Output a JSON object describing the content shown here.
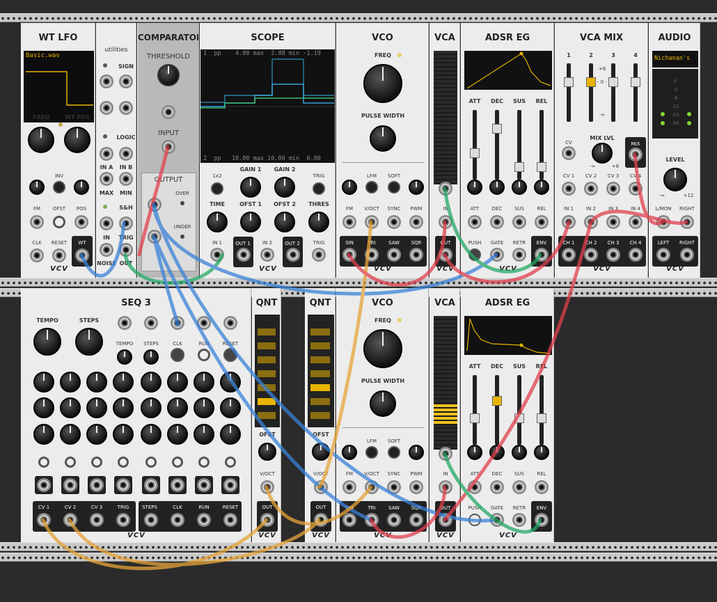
{
  "colors": {
    "red": "#e0404e",
    "green": "#24a866",
    "blue": "#3a82d8",
    "yellow": "#e6a43a"
  },
  "modules": {
    "wtlfo": {
      "title": "WT LFO",
      "file": "Basic.wav",
      "freq": "FREQ",
      "wtpos": "WT POS",
      "inv": "INV",
      "fm": "FM",
      "ofst": "OFST",
      "pos": "POS",
      "clk": "CLK",
      "reset": "RESET",
      "wt": "WT",
      "brand": "VCV"
    },
    "util": {
      "title": "utilities",
      "sign": "SIGN",
      "logic": "LOGIC",
      "ina": "IN A",
      "inb": "IN B",
      "max": "MAX",
      "min": "MIN",
      "sh": "S&H",
      "in": "IN",
      "trig": "TRIG",
      "noise": "NOISE",
      "out": "OUT"
    },
    "comp": {
      "title": "COMPARATOR",
      "threshold": "THRESHOLD",
      "input": "INPUT",
      "output": "OUTPUT",
      "over": "OVER",
      "under": "UNDER"
    },
    "scope": {
      "title": "SCOPE",
      "top": "1  pp    4.08 max  2.88 min -1.19",
      "bottom": "2  pp   10.00 max 10.00 min  0.00",
      "x2": "1x2",
      "gain1": "GAIN 1",
      "gain2": "GAIN 2",
      "trig": "TRIG",
      "time": "TIME",
      "ofst1": "OFST 1",
      "ofst2": "OFST 2",
      "thres": "THRES",
      "in1": "IN 1",
      "out1": "OUT 1",
      "in2": "IN 2",
      "out2": "OUT 2",
      "trigj": "TRIG",
      "brand": "VCV"
    },
    "vco": {
      "title": "VCO",
      "freq": "FREQ",
      "pw": "PULSE WIDTH",
      "lfm": "LFM",
      "soft": "SOFT",
      "fm": "FM",
      "voct": "V/OCT",
      "sync": "SYNC",
      "pwm": "PWM",
      "sin": "SIN",
      "tri": "TRI",
      "saw": "SAW",
      "sqr": "SQR",
      "brand": "VCV"
    },
    "vca": {
      "title": "VCA",
      "in": "IN",
      "out": "OUT",
      "brand": "VCV"
    },
    "adsr": {
      "title": "ADSR EG",
      "att": "ATT",
      "dec": "DEC",
      "sus": "SUS",
      "rel": "REL",
      "push": "PUSH",
      "gate": "GATE",
      "retr": "RETR",
      "env": "ENV",
      "brand": "VCV"
    },
    "vcamix": {
      "title": "VCA MIX",
      "ch1": "1",
      "ch2": "2",
      "ch3": "3",
      "ch4": "4",
      "cv": "CV",
      "mixlvl": "MIX LVL",
      "mix": "MIX",
      "cv1": "CV 1",
      "cv2": "CV 2",
      "cv3": "CV 3",
      "cv4": "CV 4",
      "in1": "IN 1",
      "in2": "IN 2",
      "in3": "IN 3",
      "in4": "IN 4",
      "c1": "CH 1",
      "c2": "CH 2",
      "c3": "CH 3",
      "c4": "CH 4",
      "db_p6": "+6",
      "db_0": "- 0 -",
      "db_inf": "-∞",
      "min": "-∞",
      "max": "+6",
      "brand": "VCV"
    },
    "audio": {
      "title": "AUDIO",
      "device": "Nichanan's",
      "level": "LEVEL",
      "lmon": "L/MON",
      "right": "RIGHT",
      "left": "LEFT",
      "rightout": "RIGHT",
      "min": "-∞",
      "max": "+12",
      "meter": [
        "0",
        "-3",
        "-6",
        "-12",
        "-24",
        "-36"
      ],
      "brand": "VCV"
    },
    "seq": {
      "title": "SEQ 3",
      "tempo": "TEMPO",
      "steps": "STEPS",
      "tempo2": "TEMPO",
      "steps2": "STEPS",
      "clk": "CLK",
      "run": "RUN",
      "reset": "RESET",
      "cv1": "CV 1",
      "cv2": "CV 2",
      "cv3": "CV 3",
      "trig": "TRIG",
      "steps3": "STEPS",
      "clk2": "CLK",
      "run2": "RUN",
      "reset2": "RESET",
      "brand": "VCV"
    },
    "qnt": {
      "title": "QNT",
      "ofst": "OFST",
      "voct": "V/OCT",
      "out": "OUT",
      "brand": "VCV"
    }
  }
}
